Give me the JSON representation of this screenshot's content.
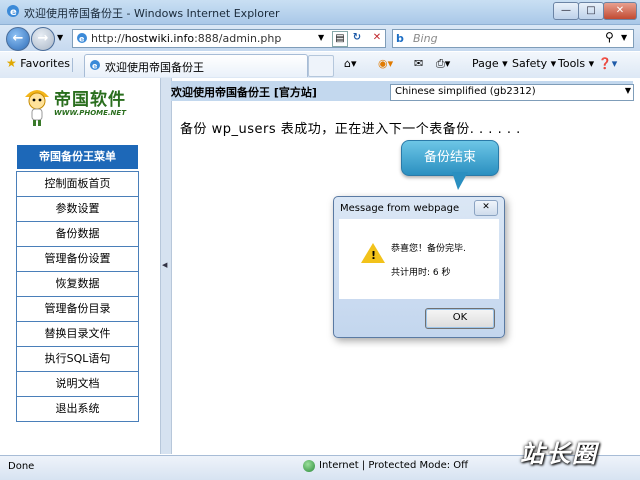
{
  "window": {
    "title": "欢迎使用帝国备份王 - Windows Internet Explorer",
    "minimize": "—",
    "maximize": "□",
    "close": "✕"
  },
  "address": {
    "url_prefix": "http://",
    "url_host": "hostwiki.info",
    "url_rest": ":888/admin.php",
    "search_placeholder": "Bing"
  },
  "favorites": {
    "favorites_label": "Favorites",
    "tab_label": "欢迎使用帝国备份王",
    "commands": {
      "page": "Page",
      "safety": "Safety",
      "tools": "Tools"
    }
  },
  "logo": {
    "name": "帝国软件",
    "url": "WWW.PHOME.NET"
  },
  "menu": {
    "header": "帝国备份王菜单",
    "items": [
      {
        "label": "控制面板首页"
      },
      {
        "label": "参数设置"
      },
      {
        "label": "备份数据"
      },
      {
        "label": "管理备份设置"
      },
      {
        "label": "恢复数据"
      },
      {
        "label": "管理备份目录"
      },
      {
        "label": "替换目录文件"
      },
      {
        "label": "执行SQL语句"
      },
      {
        "label": "说明文档"
      },
      {
        "label": "退出系统"
      }
    ]
  },
  "main": {
    "header": "欢迎使用帝国备份王 [官方站]",
    "language_selected": "Chinese simplified (gb2312)",
    "message": "备份 wp_users 表成功，正在进入下一个表备份. . . . . ."
  },
  "callout": {
    "text": "备份结束"
  },
  "dialog": {
    "title": "Message from webpage",
    "line1": "恭喜您！备份完毕.",
    "line2": "共计用时: 6 秒",
    "ok_label": "OK"
  },
  "status": {
    "text": "Done",
    "zone": "Internet | Protected Mode: Off"
  },
  "watermark": {
    "text": "站长圈"
  }
}
